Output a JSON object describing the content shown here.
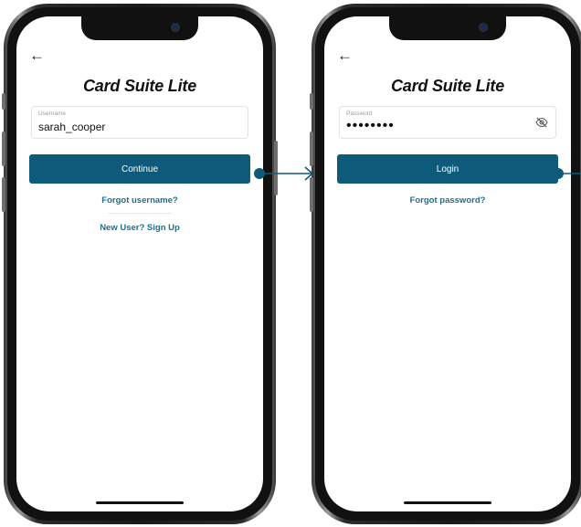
{
  "screens": {
    "username": {
      "app_title": "Card Suite Lite",
      "back_icon": "←",
      "username_field": {
        "label": "Username",
        "value": "sarah_cooper"
      },
      "continue_label": "Continue",
      "forgot_username": "Forgot username?",
      "signup_link": "New User? Sign Up"
    },
    "password": {
      "app_title": "Card Suite Lite",
      "back_icon": "←",
      "password_field": {
        "label": "Password",
        "value": "••••••••"
      },
      "login_label": "Login",
      "forgot_password": "Forgot password?"
    }
  },
  "colors": {
    "primary_button": "#0e5a7a",
    "link": "#1d6f93",
    "connector": "#0e5a7a"
  },
  "icons": [
    "back-arrow-icon",
    "eye-slash-icon",
    "right-arrow-icon"
  ]
}
